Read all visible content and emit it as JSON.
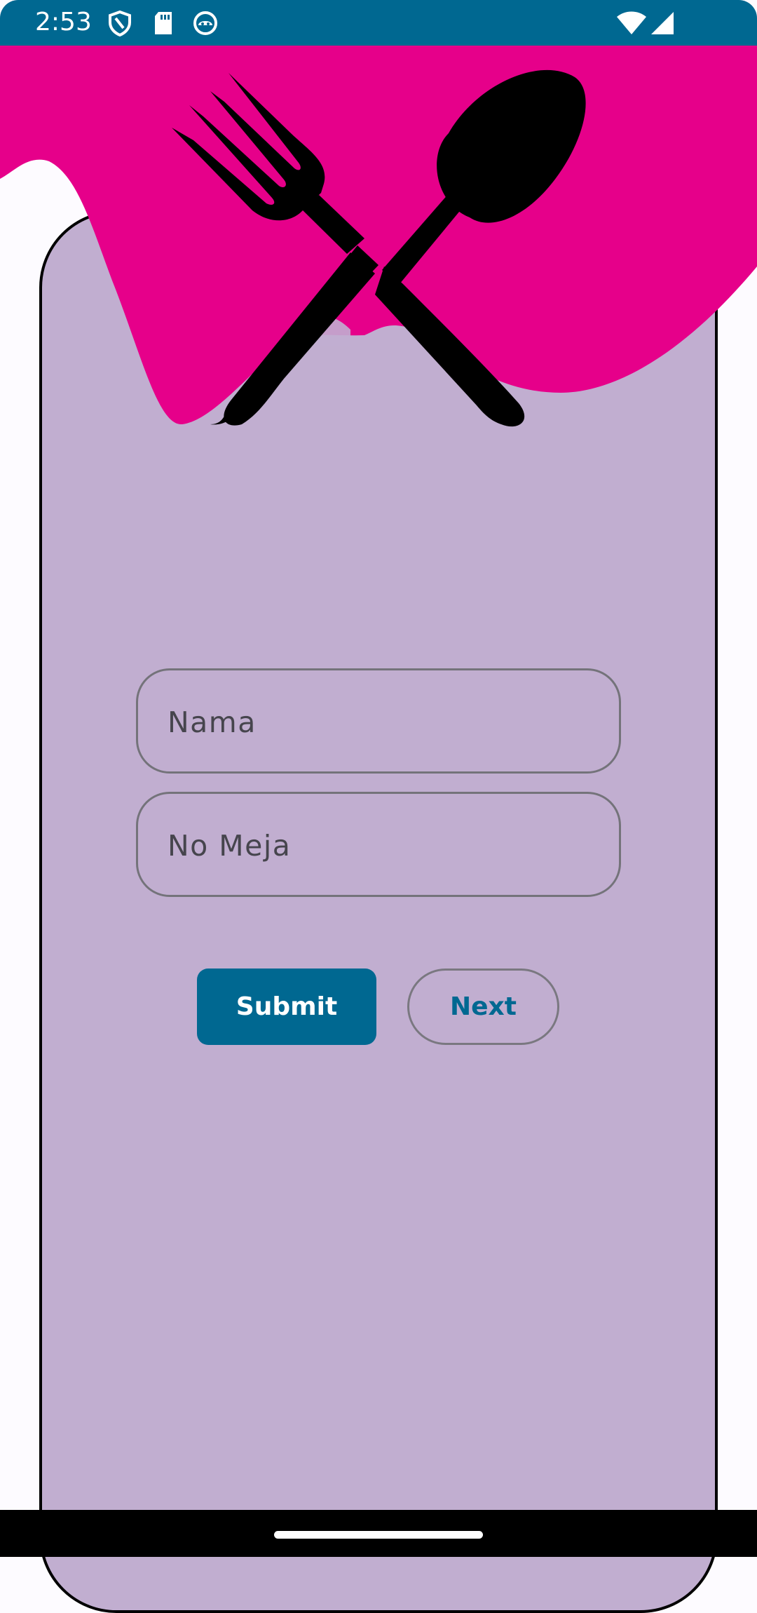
{
  "status_bar": {
    "time": "2:53",
    "icons": [
      "shield-icon",
      "sd-card-icon",
      "android-debug-icon",
      "wifi-icon",
      "cell-signal-icon"
    ]
  },
  "header": {
    "icon": "fork-and-spoon-icon",
    "colors": {
      "brand_pink": "#e6008a",
      "card_bg": "#c1aed0"
    }
  },
  "form": {
    "name_placeholder": "Nama",
    "table_placeholder": "No Meja"
  },
  "buttons": {
    "submit_label": "Submit",
    "next_label": "Next",
    "accent": "#006891"
  }
}
